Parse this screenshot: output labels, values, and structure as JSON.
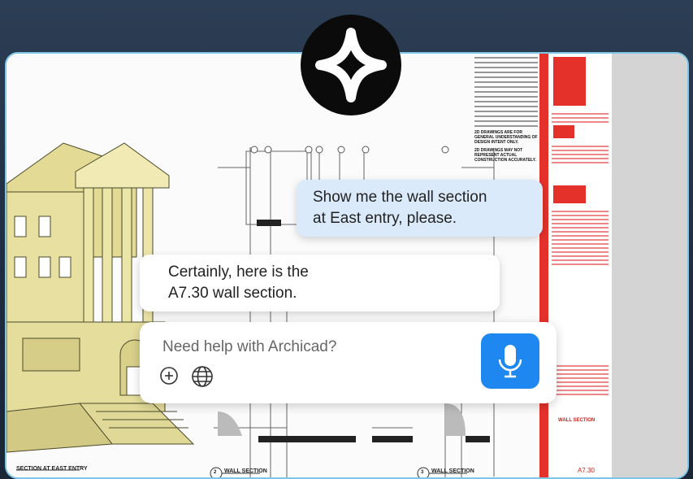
{
  "chat": {
    "user_message_line1": "Show me the wall section",
    "user_message_line2": "at East entry, please.",
    "bot_message_line1": "Certainly, here is the",
    "bot_message_line2": "A7.30 wall section."
  },
  "input": {
    "placeholder": "Need help with Archicad?",
    "add_icon": "plus-circle-icon",
    "web_icon": "globe-icon",
    "mic_icon": "microphone-icon"
  },
  "drawing": {
    "perspective_label": "SECTION AT EAST ENTRY",
    "wall_section_label_1": "WALL SECTION",
    "wall_section_label_2": "WALL SECTION",
    "marker_1": "2",
    "marker_2": "3",
    "notes_line1": "2D DRAWINGS ARE FOR GENERAL UNDERSTANDING OF DESIGN INTENT ONLY.",
    "notes_line2": "2D DRAWINGS MAY NOT REPRESENT ACTUAL CONSTRUCTION ACCURATELY.",
    "sheet_title": "WALL SECTION",
    "sheet_number": "A7.30"
  },
  "colors": {
    "accent_blue": "#1f88f0",
    "user_bubble": "#dbeafb",
    "titleblock_red": "#e4322b",
    "building": "#ece5a8"
  }
}
